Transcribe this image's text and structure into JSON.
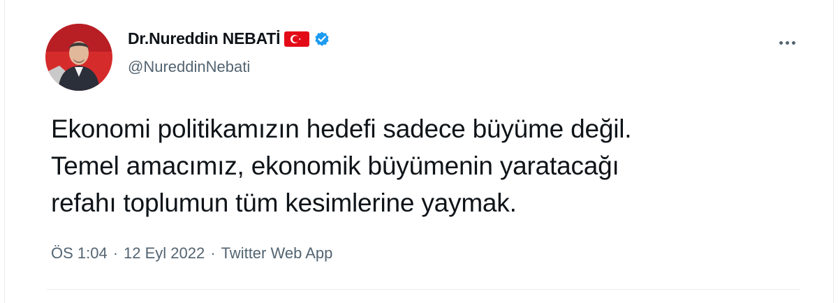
{
  "tweet": {
    "author": {
      "display_name": "Dr.Nureddin NEBATİ",
      "handle": "@NureddinNebati",
      "flag_icon": "turkey-flag-icon",
      "verified_icon": "verified-badge-icon"
    },
    "text_lines": [
      "Ekonomi politikamızın hedefi sadece büyüme değil.",
      "Temel amacımız, ekonomik büyümenin yaratacağı",
      "refahı toplumun tüm kesimlerine yaymak."
    ],
    "meta": {
      "time": "ÖS 1:04",
      "separator": "·",
      "date": "12 Eyl 2022",
      "source": "Twitter Web App"
    }
  },
  "colors": {
    "text": "#0f1419",
    "secondary": "#536471",
    "verified": "#1d9bf0",
    "flag_red": "#e30a17",
    "avatar_bg": "#d62b2b"
  }
}
